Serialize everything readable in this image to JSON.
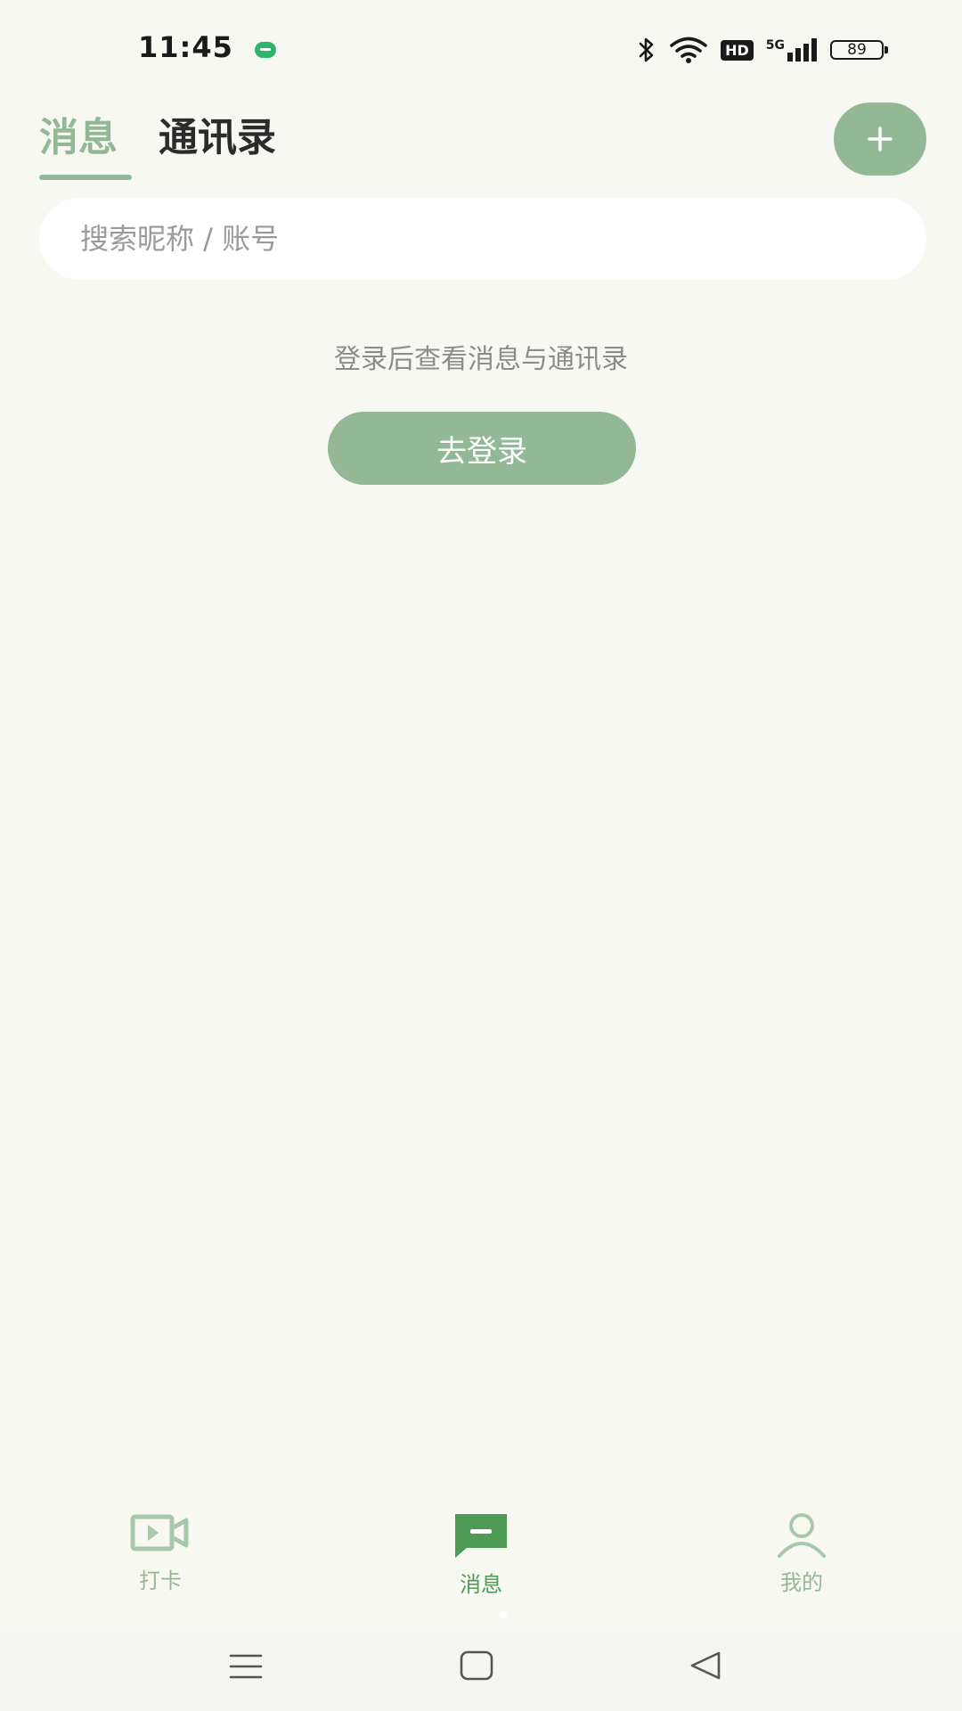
{
  "status_bar": {
    "time": "11:45",
    "network": "5G",
    "hd": "HD",
    "battery": "89"
  },
  "header": {
    "tabs": [
      {
        "label": "消息",
        "active": true
      },
      {
        "label": "通讯录",
        "active": false
      }
    ],
    "add_icon": "plus-icon"
  },
  "search": {
    "placeholder": "搜索昵称 / 账号",
    "value": ""
  },
  "empty_state": {
    "message": "登录后查看消息与通讯录",
    "login_button": "去登录"
  },
  "bottom_nav": {
    "items": [
      {
        "label": "打卡",
        "icon": "video-camera-icon",
        "active": false
      },
      {
        "label": "消息",
        "icon": "message-icon",
        "active": true
      },
      {
        "label": "我的",
        "icon": "person-icon",
        "active": false
      }
    ]
  },
  "colors": {
    "accent": "#93b896",
    "active_nav": "#4e9a55",
    "background": "#f8f8f3"
  }
}
